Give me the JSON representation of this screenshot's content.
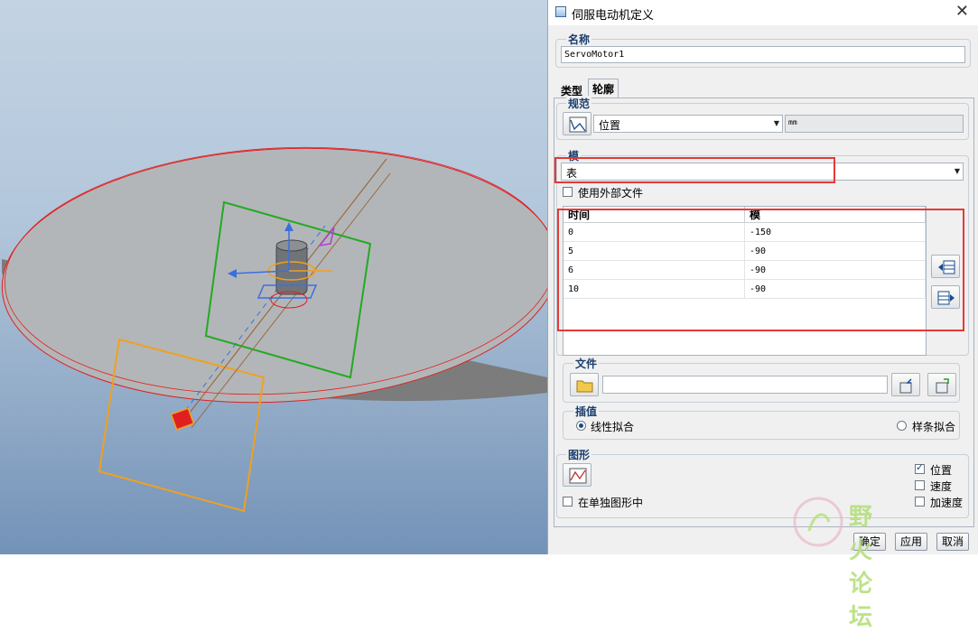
{
  "dialog": {
    "title": "伺服电动机定义",
    "name_group": {
      "label": "名称",
      "value": "ServoMotor1"
    },
    "tabs": [
      {
        "label": "类型",
        "active": false
      },
      {
        "label": "轮廓",
        "active": true
      }
    ],
    "spec_group": {
      "label": "规范",
      "selected": "位置",
      "unit": "mm"
    },
    "module_group": {
      "label": "模",
      "selected": "表",
      "use_external_file_label": "使用外部文件",
      "use_external_file_checked": false,
      "table": {
        "columns": [
          "时间",
          "模"
        ],
        "rows": [
          [
            "0",
            "-150"
          ],
          [
            "5",
            "-90"
          ],
          [
            "6",
            "-90"
          ],
          [
            "10",
            "-90"
          ]
        ]
      }
    },
    "file_group": {
      "label": "文件",
      "value": ""
    },
    "interp_group": {
      "label": "插值",
      "options": [
        {
          "label": "线性拟合",
          "selected": true
        },
        {
          "label": "样条拟合",
          "selected": false
        }
      ]
    },
    "graph_group": {
      "label": "图形",
      "checks": [
        {
          "label": "位置",
          "checked": true
        },
        {
          "label": "速度",
          "checked": false
        },
        {
          "label": "加速度",
          "checked": false
        }
      ],
      "separate_graph_label": "在单独图形中",
      "separate_graph_checked": false
    },
    "buttons": {
      "ok": "确定",
      "apply": "应用",
      "cancel": "取消"
    }
  },
  "watermark": {
    "text": "野火论坛"
  },
  "colors": {
    "highlight_box": "#e53935",
    "accent": "#1a4b8c"
  }
}
